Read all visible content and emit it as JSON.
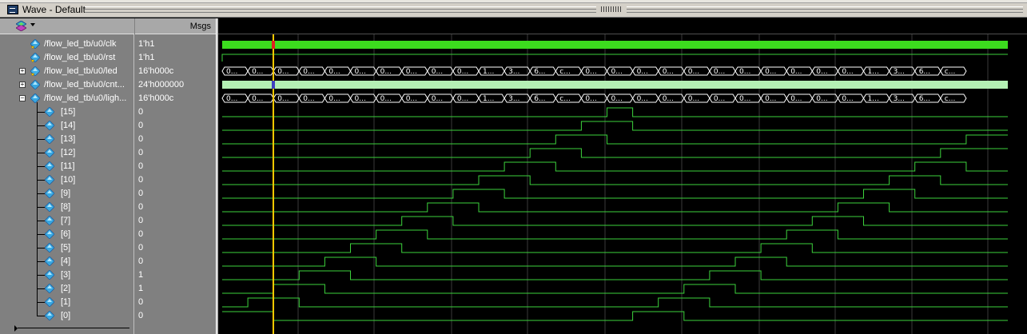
{
  "window": {
    "title": "Wave - Default"
  },
  "header": {
    "msgs_label": "Msgs"
  },
  "signals": [
    {
      "name": "/flow_led_tb/u0/clk",
      "value": "1'h1",
      "kind": "wire",
      "expandable": false
    },
    {
      "name": "/flow_led_tb/u0/rst",
      "value": "1'h1",
      "kind": "wire",
      "expandable": false
    },
    {
      "name": "/flow_led_tb/u0/led",
      "value": "16'h000c",
      "kind": "output",
      "expandable": true
    },
    {
      "name": "/flow_led_tb/u0/cnt...",
      "value": "24'h000000",
      "kind": "reg",
      "expandable": true
    },
    {
      "name": "/flow_led_tb/u0/ligh...",
      "value": "16'h000c",
      "kind": "reg",
      "expandable": true,
      "expanded": true
    }
  ],
  "bits": [
    {
      "label": "[15]",
      "value": "0"
    },
    {
      "label": "[14]",
      "value": "0"
    },
    {
      "label": "[13]",
      "value": "0"
    },
    {
      "label": "[12]",
      "value": "0"
    },
    {
      "label": "[11]",
      "value": "0"
    },
    {
      "label": "[10]",
      "value": "0"
    },
    {
      "label": "[9]",
      "value": "0"
    },
    {
      "label": "[8]",
      "value": "0"
    },
    {
      "label": "[7]",
      "value": "0"
    },
    {
      "label": "[6]",
      "value": "0"
    },
    {
      "label": "[5]",
      "value": "0"
    },
    {
      "label": "[4]",
      "value": "0"
    },
    {
      "label": "[3]",
      "value": "1"
    },
    {
      "label": "[2]",
      "value": "1"
    },
    {
      "label": "[1]",
      "value": "0"
    },
    {
      "label": "[0]",
      "value": "0"
    }
  ],
  "bus_values": [
    "0...",
    "0...",
    "0...",
    "0...",
    "0...",
    "0...",
    "0...",
    "0...",
    "0...",
    "0...",
    "1...",
    "3...",
    "6...",
    "c...",
    "0...",
    "0...",
    "0...",
    "0...",
    "0...",
    "0...",
    "0...",
    "0...",
    "0...",
    "0...",
    "0...",
    "1...",
    "3...",
    "6...",
    "c..."
  ],
  "colors": {
    "signal_green": "#3cd23c",
    "clk_fill": "#3cdc1e",
    "cnt_fill": "#b4f0b4",
    "cursor": "#ffc800",
    "grid": "#3a3a3a"
  },
  "icons": {
    "layout": "layout-icon",
    "signal": "diamond-signal-icon"
  }
}
